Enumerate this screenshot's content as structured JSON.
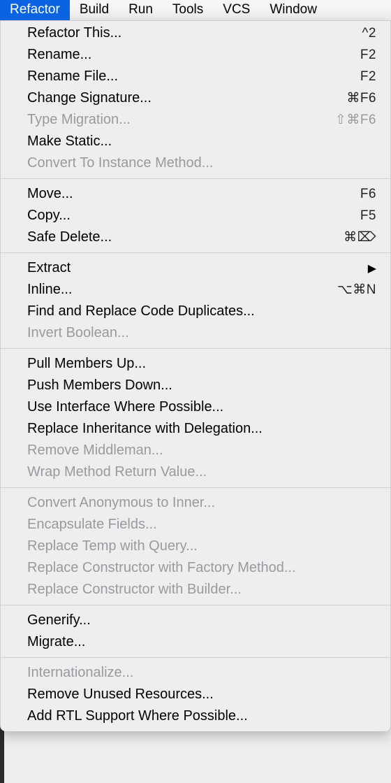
{
  "menubar": [
    {
      "label": "Refactor",
      "active": true
    },
    {
      "label": "Build",
      "active": false
    },
    {
      "label": "Run",
      "active": false
    },
    {
      "label": "Tools",
      "active": false
    },
    {
      "label": "VCS",
      "active": false
    },
    {
      "label": "Window",
      "active": false
    }
  ],
  "menu_groups": [
    [
      {
        "label": "Refactor This...",
        "shortcut": "^2",
        "enabled": true,
        "submenu": false
      },
      {
        "label": "Rename...",
        "shortcut": "F2",
        "enabled": true,
        "submenu": false
      },
      {
        "label": "Rename File...",
        "shortcut": "F2",
        "enabled": true,
        "submenu": false
      },
      {
        "label": "Change Signature...",
        "shortcut": "⌘F6",
        "enabled": true,
        "submenu": false
      },
      {
        "label": "Type Migration...",
        "shortcut": "⇧⌘F6",
        "enabled": false,
        "submenu": false
      },
      {
        "label": "Make Static...",
        "shortcut": "",
        "enabled": true,
        "submenu": false
      },
      {
        "label": "Convert To Instance Method...",
        "shortcut": "",
        "enabled": false,
        "submenu": false
      }
    ],
    [
      {
        "label": "Move...",
        "shortcut": "F6",
        "enabled": true,
        "submenu": false
      },
      {
        "label": "Copy...",
        "shortcut": "F5",
        "enabled": true,
        "submenu": false
      },
      {
        "label": "Safe Delete...",
        "shortcut": "⌘⌦",
        "enabled": true,
        "submenu": false
      }
    ],
    [
      {
        "label": "Extract",
        "shortcut": "",
        "enabled": true,
        "submenu": true
      },
      {
        "label": "Inline...",
        "shortcut": "⌥⌘N",
        "enabled": true,
        "submenu": false
      },
      {
        "label": "Find and Replace Code Duplicates...",
        "shortcut": "",
        "enabled": true,
        "submenu": false
      },
      {
        "label": "Invert Boolean...",
        "shortcut": "",
        "enabled": false,
        "submenu": false
      }
    ],
    [
      {
        "label": "Pull Members Up...",
        "shortcut": "",
        "enabled": true,
        "submenu": false
      },
      {
        "label": "Push Members Down...",
        "shortcut": "",
        "enabled": true,
        "submenu": false
      },
      {
        "label": "Use Interface Where Possible...",
        "shortcut": "",
        "enabled": true,
        "submenu": false
      },
      {
        "label": "Replace Inheritance with Delegation...",
        "shortcut": "",
        "enabled": true,
        "submenu": false
      },
      {
        "label": "Remove Middleman...",
        "shortcut": "",
        "enabled": false,
        "submenu": false
      },
      {
        "label": "Wrap Method Return Value...",
        "shortcut": "",
        "enabled": false,
        "submenu": false
      }
    ],
    [
      {
        "label": "Convert Anonymous to Inner...",
        "shortcut": "",
        "enabled": false,
        "submenu": false
      },
      {
        "label": "Encapsulate Fields...",
        "shortcut": "",
        "enabled": false,
        "submenu": false
      },
      {
        "label": "Replace Temp with Query...",
        "shortcut": "",
        "enabled": false,
        "submenu": false
      },
      {
        "label": "Replace Constructor with Factory Method...",
        "shortcut": "",
        "enabled": false,
        "submenu": false
      },
      {
        "label": "Replace Constructor with Builder...",
        "shortcut": "",
        "enabled": false,
        "submenu": false
      }
    ],
    [
      {
        "label": "Generify...",
        "shortcut": "",
        "enabled": true,
        "submenu": false
      },
      {
        "label": "Migrate...",
        "shortcut": "",
        "enabled": true,
        "submenu": false
      }
    ],
    [
      {
        "label": "Internationalize...",
        "shortcut": "",
        "enabled": false,
        "submenu": false
      },
      {
        "label": "Remove Unused Resources...",
        "shortcut": "",
        "enabled": true,
        "submenu": false
      },
      {
        "label": "Add RTL Support Where Possible...",
        "shortcut": "",
        "enabled": true,
        "submenu": false
      }
    ]
  ]
}
